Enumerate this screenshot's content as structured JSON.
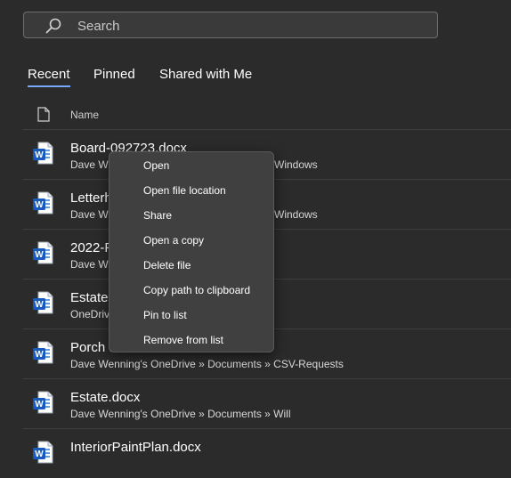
{
  "search": {
    "placeholder": "Search"
  },
  "tabs": [
    {
      "label": "Recent",
      "active": true
    },
    {
      "label": "Pinned",
      "active": false
    },
    {
      "label": "Shared with Me",
      "active": false
    }
  ],
  "columns": {
    "name": "Name"
  },
  "files": [
    {
      "name": "Board-092723.docx",
      "path_start": "Dave We",
      "path_end": "Windows"
    },
    {
      "name": "Letterh",
      "path_start": "Dave We",
      "path_end": "Windows"
    },
    {
      "name": "2022-F",
      "path_start": "Dave We",
      "path_end": ""
    },
    {
      "name": "Estate.",
      "path_start": "OneDriv",
      "path_end": ""
    },
    {
      "name": "Porch I",
      "path": "Dave Wenning's OneDrive » Documents » CSV-Requests"
    },
    {
      "name": "Estate.docx",
      "path": "Dave Wenning's OneDrive » Documents » Will"
    },
    {
      "name": "InteriorPaintPlan.docx",
      "path": ""
    }
  ],
  "context_menu": {
    "items": [
      "Open",
      "Open file location",
      "Share",
      "Open a copy",
      "Delete file",
      "Copy path to clipboard",
      "Pin to list",
      "Remove from list"
    ]
  },
  "colors": {
    "accent": "#7aa7ff",
    "word_blue": "#2b7cd3",
    "word_dark": "#185abd"
  },
  "icons": {
    "search": "search-icon",
    "document": "document-icon",
    "word": "word-file-icon"
  }
}
